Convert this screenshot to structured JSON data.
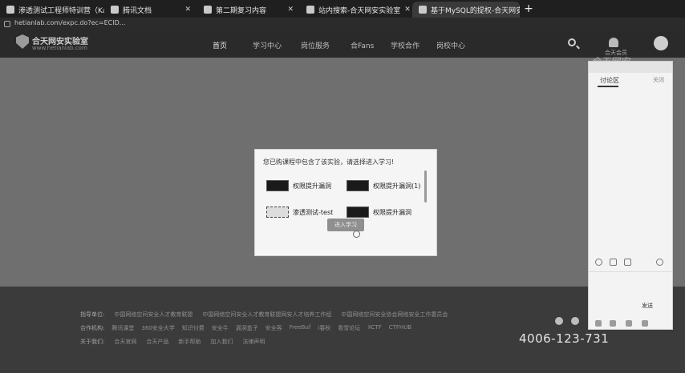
{
  "browser": {
    "tabs": [
      {
        "title": "渗透测试工程师特训营（Kali版）"
      },
      {
        "title": "腾讯文档"
      },
      {
        "title": "第二期复习内容"
      },
      {
        "title": "站内搜索-合天网安实验室"
      },
      {
        "title": "基于MySQL的提权-合天网安实..."
      }
    ],
    "new_tab": "+",
    "url": "hetianlab.com/expc.do?ec=ECID..."
  },
  "header": {
    "logo_title": "合天网安实验室",
    "logo_subtitle": "www.hetianlab.com",
    "nav": [
      "首页",
      "学习中心",
      "岗位服务",
      "合Fans",
      "学校合作",
      "岗校中心"
    ],
    "user": "合天会员",
    "watermark": "合天网安"
  },
  "modal": {
    "title": "您已购课程中包含了该实验，请选择进入学习!",
    "labs": [
      "权限提升漏洞",
      "权限提升漏洞(1)",
      "渗透测试-test",
      "权限提升漏洞"
    ],
    "button": "进入学习"
  },
  "footer": {
    "rows": [
      [
        "指导单位:",
        "中国网络空间安全人才教育联盟",
        "中国网络空间安全人才教育联盟网安人才培养工作组",
        "中国网络空间安全协会网络安全工作委员会"
      ],
      [
        "合作机构:",
        "腾讯课堂",
        "360安全大学",
        "知识付费",
        "安全牛",
        "漏洞盒子",
        "安全客",
        "FreeBuf",
        "i春秋",
        "看雪论坛",
        "XCTF",
        "CTFHUB"
      ],
      [
        "关于我们:",
        "合天官网",
        "合天产品",
        "新手帮助",
        "加入我们",
        "法律声明"
      ]
    ],
    "phone": "4006-123-731"
  },
  "panel": {
    "tab": "讨论区",
    "tab2": "关闭",
    "send": "发送"
  }
}
